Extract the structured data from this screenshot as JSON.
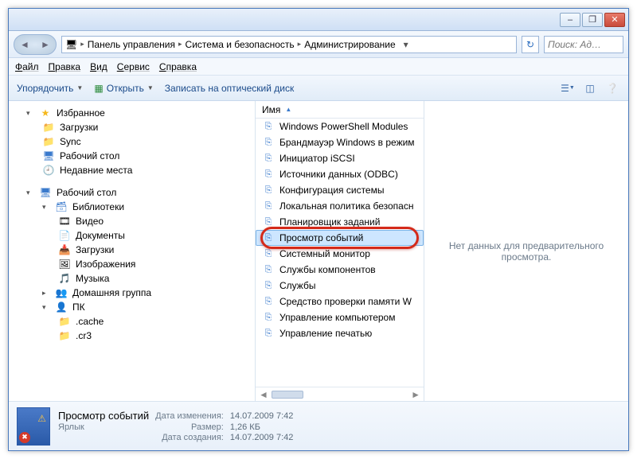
{
  "titlebar": {
    "min": "–",
    "max": "❐",
    "close": "✕"
  },
  "breadcrumbs": {
    "root_icon": "▸",
    "items": [
      "Панель управления",
      "Система и безопасность",
      "Администрирование"
    ]
  },
  "search": {
    "placeholder": "Поиск: Ад…"
  },
  "menu": {
    "file": "Файл",
    "edit": "Правка",
    "view": "Вид",
    "service": "Сервис",
    "help": "Справка"
  },
  "toolbar": {
    "organize": "Упорядочить",
    "open": "Открыть",
    "burn": "Записать на оптический диск"
  },
  "nav": {
    "favorites": {
      "label": "Избранное",
      "items": [
        "Загрузки",
        "Sync",
        "Рабочий стол",
        "Недавние места"
      ]
    },
    "desktop": {
      "label": "Рабочий стол"
    },
    "libraries": {
      "label": "Библиотеки",
      "items": [
        "Видео",
        "Документы",
        "Загрузки",
        "Изображения",
        "Музыка"
      ]
    },
    "homegroup": {
      "label": "Домашняя группа"
    },
    "pc": {
      "label": "ПК",
      "items": [
        ".cache",
        ".cr3"
      ]
    }
  },
  "column_header": "Имя",
  "files": [
    "Windows PowerShell Modules",
    "Брандмауэр Windows в режим",
    "Инициатор iSCSI",
    "Источники данных (ODBC)",
    "Конфигурация системы",
    "Локальная политика безопасн",
    "Планировщик заданий",
    "Просмотр событий",
    "Системный монитор",
    "Службы компонентов",
    "Службы",
    "Средство проверки памяти W",
    "Управление компьютером",
    "Управление печатью"
  ],
  "selected_index": 7,
  "preview_text": "Нет данных для предварительного просмотра.",
  "details": {
    "name": "Просмотр событий",
    "type": "Ярлык",
    "modified_label": "Дата изменения:",
    "modified": "14.07.2009 7:42",
    "size_label": "Размер:",
    "size": "1,26 КБ",
    "created_label": "Дата создания:",
    "created": "14.07.2009 7:42"
  }
}
